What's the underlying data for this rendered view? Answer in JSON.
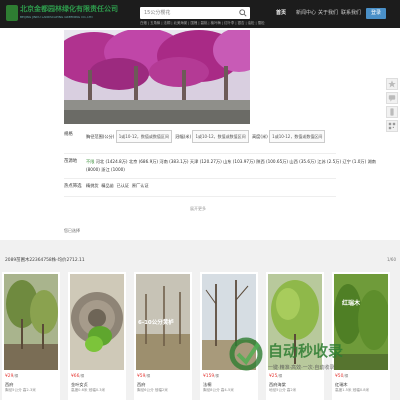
{
  "header": {
    "logo_cn": "北京金都园林绿化有限责任公司",
    "logo_en": "BEIJING JINDU LANDSCAPING GREENING CO.,LTD",
    "search_value": "15公分樱花",
    "hotkeys": "白蜡 | 五角枫 | 法桐 | 北美海棠 | 国槐 | 碧桃 | 榆叶梅 | 红叶李 | 银杏 | 油松 | 雪松",
    "nav": [
      "首页",
      "新闻中心",
      "关于我们",
      "联系我们"
    ],
    "login_label": "登录"
  },
  "filters": {
    "spec_label": "规格",
    "spec_items": [
      "胸径范围(公分)",
      "1或10-12，数值或数值区间",
      "冠幅(米)",
      "1或10-12，数值或数值区间",
      "高度(米)",
      "1或10-12，数值或数值区间"
    ],
    "origin_label": "苗源地",
    "origin_all": "不限",
    "origins_row1": [
      "河北 (1424.8万)",
      "北京 (686.9万)",
      "河南 (383.1万)",
      "天津 (120.27万)",
      "山东 (103.97万)",
      "陕西 (100.65万)",
      "山西 (35.6万)",
      "江苏 (2.5万)"
    ],
    "origins_row2": [
      "辽宁 (1.0万)",
      "湖南 (8000)",
      "浙江 (1000)"
    ],
    "hot_label": "热点筛选",
    "hot_items": [
      "精挑货",
      "精品苗",
      "已认证",
      "原厂认证"
    ],
    "more_label": "展开更多",
    "filter_tip": "您已选择"
  },
  "results": {
    "summary": "2089苗圃木22364758株-均价2712.11",
    "pager": "1/60"
  },
  "cards": [
    {
      "price": "¥29",
      "unit": "/棵",
      "name": "西府",
      "spec": "胸径5公分 高2-3米"
    },
    {
      "price": "¥66",
      "unit": "/棵",
      "name": "金叶女贞",
      "spec": "高度0.6米 冠幅0.3米"
    },
    {
      "price": "¥59",
      "unit": "/棵",
      "name": "西府",
      "spec": "胸径6公分 冠幅2米"
    },
    {
      "price": "¥159",
      "unit": "/棵",
      "name": "法桐",
      "spec": "胸径8公分 高4-5米"
    },
    {
      "price": "¥25",
      "unit": "/棵",
      "name": "西府海棠",
      "spec": "地径5公分 高2米"
    },
    {
      "price": "¥50",
      "unit": "/棵",
      "name": "红瑞木",
      "spec": "高度1.5米 冠幅0.8米"
    }
  ],
  "card_overlay_text": "6-10公分黄栌",
  "card_overlay_text2": "红瑞木",
  "watermark": {
    "title": "自动秒收录",
    "subtitle": "一键·精准·高效·一次·自动收录"
  },
  "colors": {
    "header_bg": "#1c1c1c",
    "accent": "#4a90c8",
    "price": "#e53935",
    "green": "#3a8f3a"
  }
}
